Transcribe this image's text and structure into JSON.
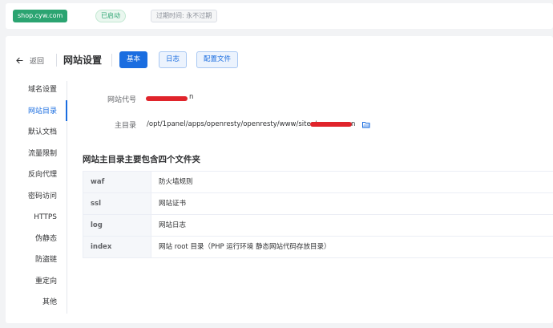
{
  "header": {
    "site_name": "shop.cyw.com",
    "status": "已启动",
    "expire": "过期时间: 永不过期"
  },
  "toolbar": {
    "back_label": "返回",
    "title": "网站设置",
    "tabs": [
      {
        "label": "基本",
        "active": true
      },
      {
        "label": "日志",
        "active": false
      },
      {
        "label": "配置文件",
        "active": false
      }
    ]
  },
  "sidebar": {
    "items": [
      {
        "label": "域名设置"
      },
      {
        "label": "网站目录",
        "active": true
      },
      {
        "label": "默认文档"
      },
      {
        "label": "流量限制"
      },
      {
        "label": "反向代理"
      },
      {
        "label": "密码访问"
      },
      {
        "label": "HTTPS"
      },
      {
        "label": "伪静态"
      },
      {
        "label": "防盗链"
      },
      {
        "label": "重定向"
      },
      {
        "label": "其他"
      }
    ]
  },
  "form": {
    "code_label": "网站代号",
    "code_value_suffix": "n",
    "root_label": "主目录",
    "root_value": "/opt/1panel/apps/openresty/openresty/www/sites/",
    "root_value_suffix": "n"
  },
  "folders": {
    "title": "网站主目录主要包含四个文件夹",
    "rows": [
      {
        "name": "waf",
        "desc": "防火墙规则"
      },
      {
        "name": "ssl",
        "desc": "网站证书"
      },
      {
        "name": "log",
        "desc": "网站日志"
      },
      {
        "name": "index",
        "desc": "网站 root 目录（PHP 运行环境 静态网站代码存放目录）"
      }
    ]
  },
  "colors": {
    "primary": "#1a6de0",
    "success": "#2ba471",
    "redaction": "#e0242b"
  }
}
